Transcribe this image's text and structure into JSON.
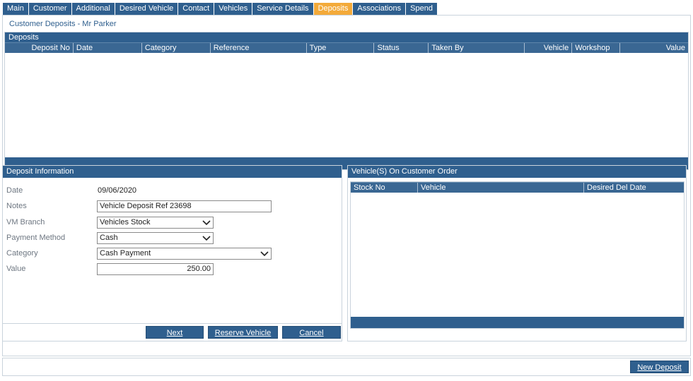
{
  "tabs": [
    "Main",
    "Customer",
    "Additional",
    "Desired Vehicle",
    "Contact",
    "Vehicles",
    "Service Details",
    "Deposits",
    "Associations",
    "Spend"
  ],
  "active_tab": "Deposits",
  "page_title": "Customer Deposits - Mr Parker",
  "deposits": {
    "heading": "Deposits",
    "columns": [
      "Deposit No",
      "Date",
      "Category",
      "Reference",
      "Type",
      "Status",
      "Taken By",
      "Vehicle",
      "Workshop",
      "Value"
    ],
    "rows": []
  },
  "deposit_info": {
    "heading": "Deposit Information",
    "date_label": "Date",
    "date_value": "09/06/2020",
    "notes_label": "Notes",
    "notes_value": "Vehicle Deposit Ref 23698",
    "branch_label": "VM Branch",
    "branch_value": "Vehicles Stock",
    "payment_label": "Payment Method",
    "payment_value": "Cash",
    "category_label": "Category",
    "category_value": "Cash Payment",
    "value_label": "Value",
    "value_value": "250.00",
    "next_label": "Next",
    "reserve_label": "Reserve Vehicle",
    "cancel_label": "Cancel"
  },
  "vehicles_order": {
    "heading": "Vehicle(S) On Customer Order",
    "columns": [
      "Stock No",
      "Vehicle",
      "Desired Del Date"
    ],
    "rows": []
  },
  "new_deposit_label": "New Deposit",
  "colors": {
    "accent": "#2f5f8e",
    "active_tab": "#f3aa3a",
    "label_grey": "#6e7782"
  }
}
